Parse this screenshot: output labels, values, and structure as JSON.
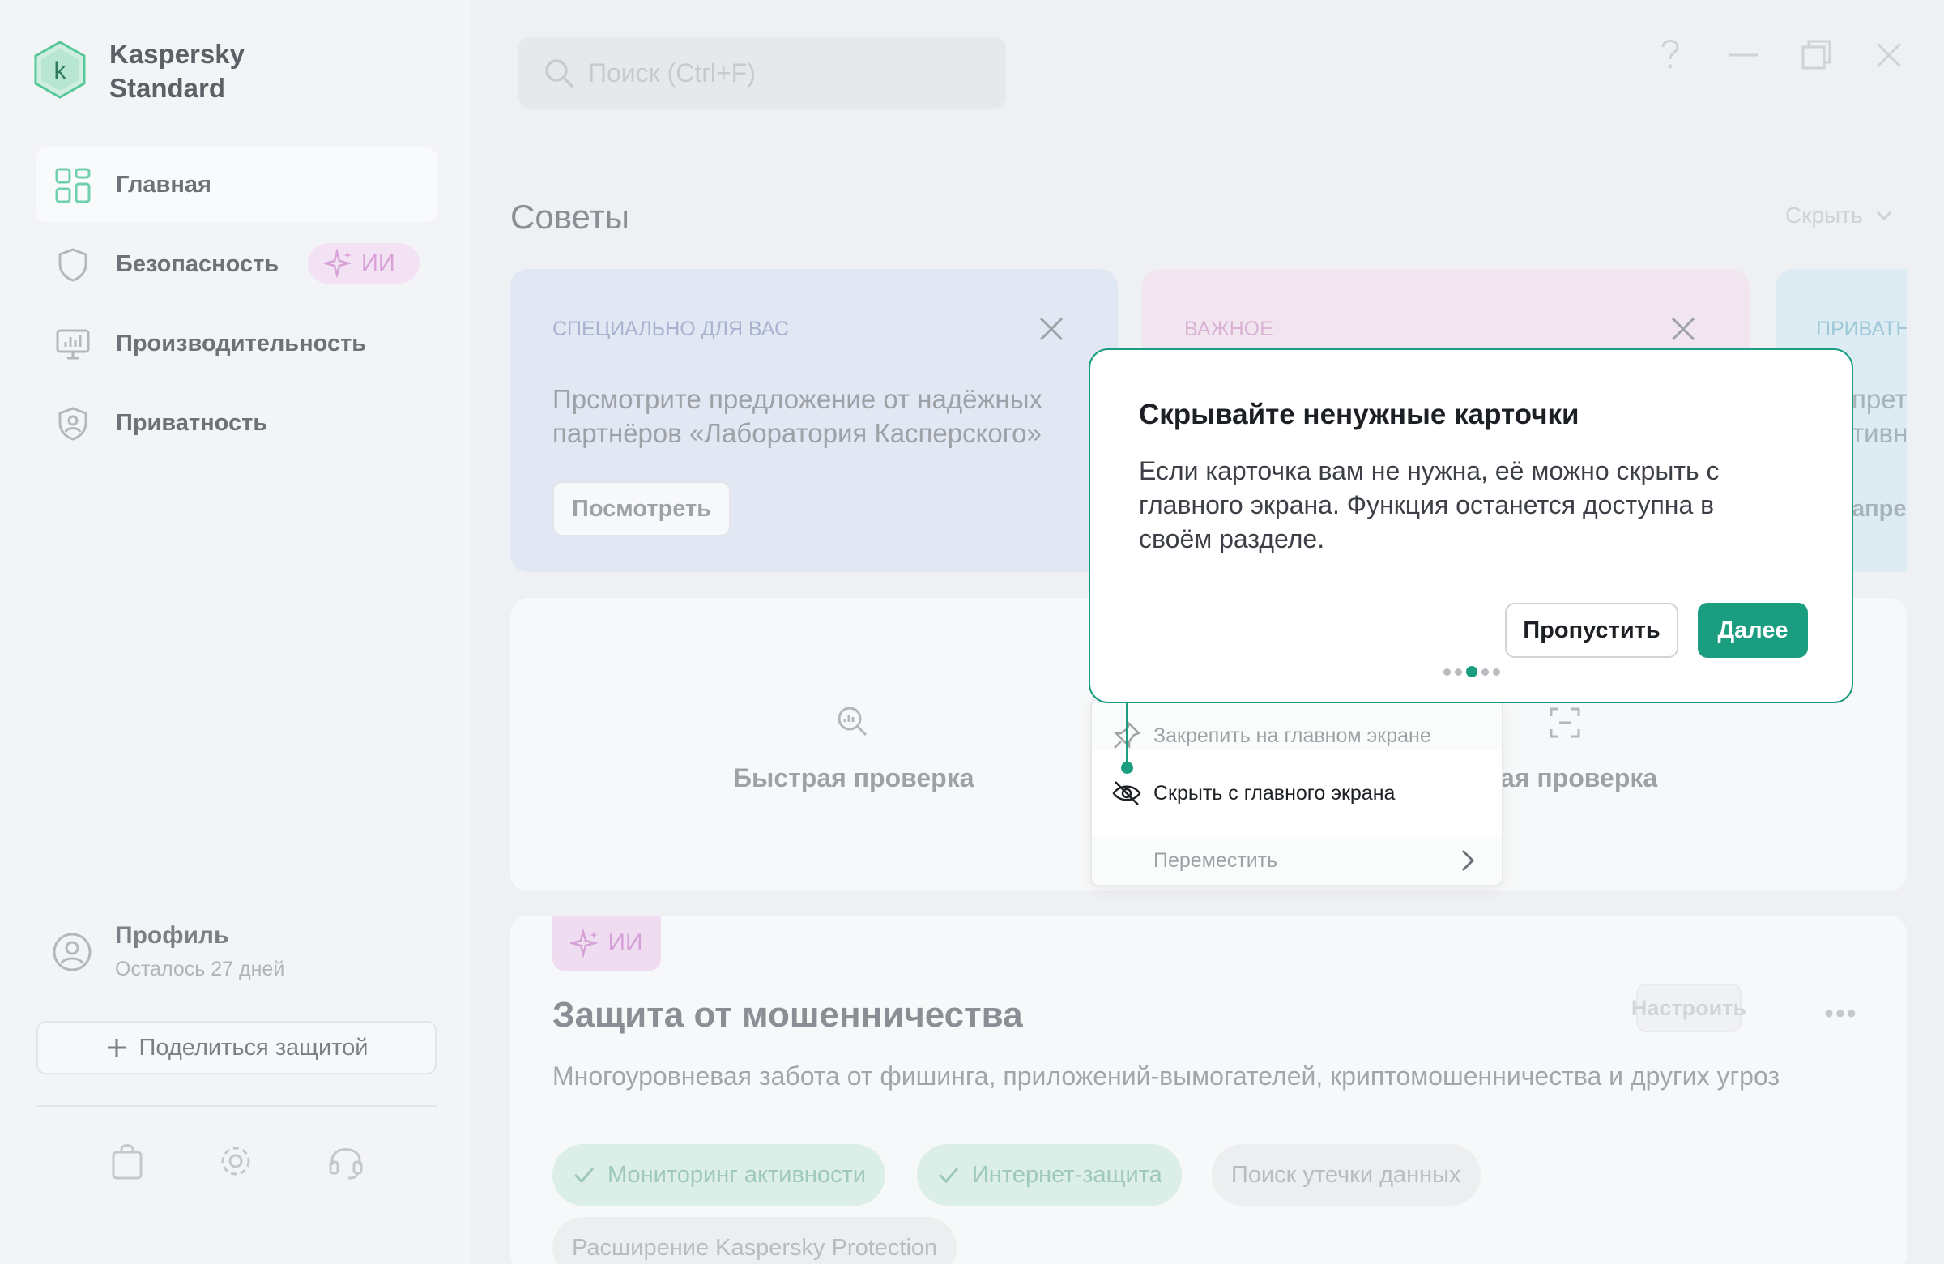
{
  "app": {
    "name": "Kaspersky Standard"
  },
  "sidebar": {
    "items": [
      {
        "label": "Главная",
        "icon": "dashboard-icon"
      },
      {
        "label": "Безопасность",
        "icon": "shield-icon",
        "badge": "ИИ"
      },
      {
        "label": "Производительность",
        "icon": "monitor-icon"
      },
      {
        "label": "Приватность",
        "icon": "privacy-shield-icon"
      }
    ],
    "profile": {
      "title": "Профиль",
      "subtitle": "Осталось 27 дней"
    },
    "share_label": "Поделиться защитой",
    "bottom_icons": [
      "store-bag-icon",
      "settings-gear-icon",
      "support-headset-icon"
    ]
  },
  "search": {
    "placeholder": "Поиск (Ctrl+F)"
  },
  "tips": {
    "title": "Советы",
    "hide_label": "Скрыть",
    "cards": [
      {
        "eyebrow": "СПЕЦИАЛЬНО ДЛЯ ВАС",
        "text": "Прсмотрите предложение от надёжных партнёров «Лаборатория Касперского»",
        "button": "Посмотреть"
      },
      {
        "eyebrow": "ВАЖНОЕ"
      },
      {
        "eyebrow": "ПРИВАТН",
        "fragments": [
          "прет",
          "тивно",
          "апре"
        ]
      }
    ]
  },
  "scan": {
    "quick_label": "Быстрая проверка",
    "second_label_fragment": "ая проверка"
  },
  "context_menu": {
    "items": [
      {
        "label": "Закрепить на главном экране",
        "icon": "pin-icon"
      },
      {
        "label": "Скрыть с главного экрана",
        "icon": "eye-off-icon"
      },
      {
        "label": "Переместить",
        "icon": "chevron-right-icon"
      }
    ]
  },
  "popover": {
    "title": "Скрывайте ненужные карточки",
    "text": "Если карточка вам не нужна, её можно скрыть с главного экрана. Функция останется доступна в своём разделе.",
    "skip_label": "Пропустить",
    "next_label": "Далее",
    "steps_total": 5,
    "step_current": 3
  },
  "fraud": {
    "badge": "ИИ",
    "title": "Защита от мошенничества",
    "description": "Многоуровневая забота от фишинга, приложений-вымогателей, криптомошенничества и других угроз",
    "configure_label": "Настроить",
    "more_label": "•••",
    "features": [
      {
        "label": "Мониторинг активности",
        "enabled": true
      },
      {
        "label": "Интернет-защита",
        "enabled": true
      },
      {
        "label": "Поиск утечки данных",
        "enabled": false
      },
      {
        "label": "Расширение Kaspersky Protection",
        "enabled": false
      }
    ]
  },
  "colors": {
    "accent": "#1b9d80",
    "ai": "#d8a2d8",
    "tip_blue": "#e1e7f3",
    "tip_pink": "#f1e6f0",
    "tip_cyan": "#dcecf2"
  }
}
